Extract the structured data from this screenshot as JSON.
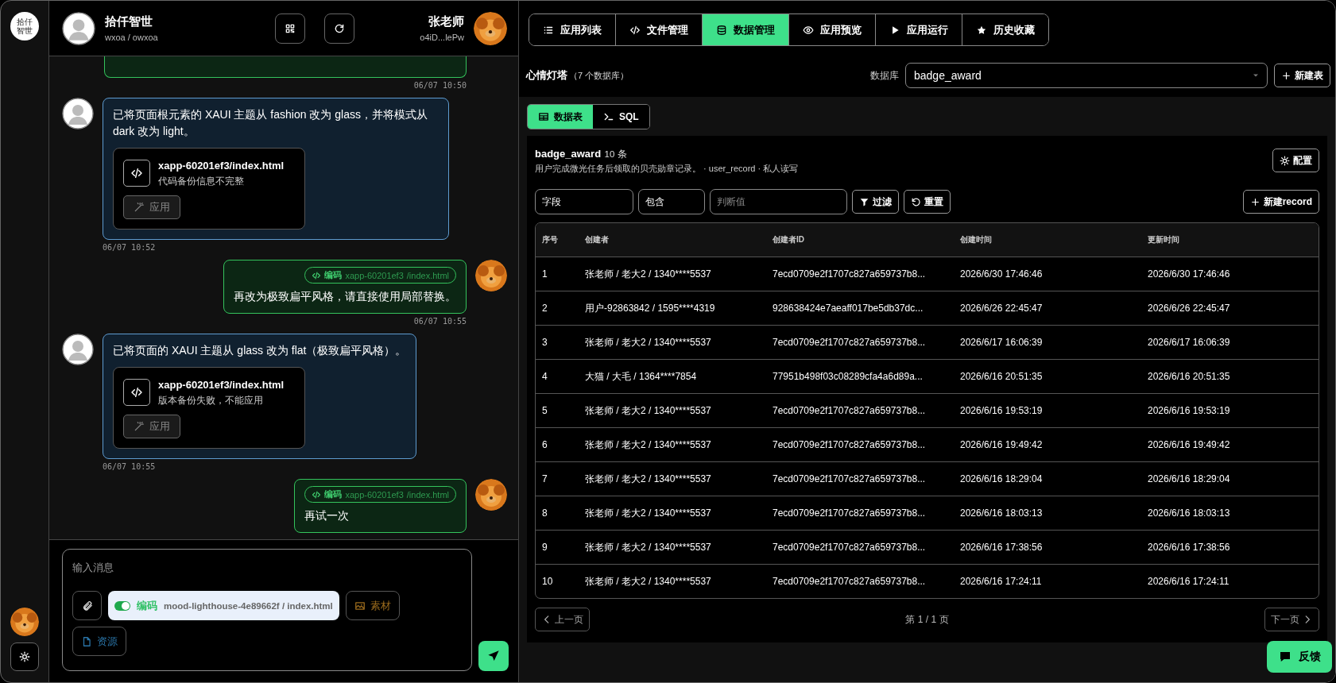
{
  "rail": {
    "logo_text": "拾仟智世"
  },
  "chat_header": {
    "name": "拾仟智世",
    "subtitle": "wxoa / owxoa",
    "user_name": "张老师",
    "user_id": "o4iD...lePw"
  },
  "messages": [
    {
      "kind": "clipped",
      "time": "06/07 10:50"
    },
    {
      "kind": "assistant",
      "text": "已将页面根元素的 XAUI 主题从 fashion 改为 glass，并将模式从 dark 改为 light。",
      "file": {
        "name": "xapp-60201ef3/index.html",
        "note": "代码备份信息不完整"
      },
      "apply": {
        "label": "应用",
        "disabled": true
      },
      "time": "06/07 10:52"
    },
    {
      "kind": "user",
      "code_ref": {
        "label": "编码",
        "project": "xapp-60201ef3",
        "file": "/index.html"
      },
      "text": "再改为极致扁平风格，请直接使用局部替换。",
      "time": "06/07 10:55"
    },
    {
      "kind": "assistant",
      "text": "已将页面的 XAUI 主题从 glass 改为 flat（极致扁平风格）。",
      "file": {
        "name": "xapp-60201ef3/index.html",
        "note": "版本备份失败，不能应用"
      },
      "apply": {
        "label": "应用",
        "disabled": true
      },
      "time": "06/07 10:55"
    },
    {
      "kind": "user",
      "code_ref": {
        "label": "编码",
        "project": "xapp-60201ef3",
        "file": "/index.html"
      },
      "text": "再试一次"
    }
  ],
  "composer": {
    "placeholder": "输入消息",
    "code_mode": {
      "on": true,
      "label": "编码",
      "path": "mood-lighthouse-4e89662f / index.html"
    },
    "assets_button": "素材",
    "resources_button": "资源"
  },
  "tabs": [
    {
      "label": "应用列表",
      "selected": false
    },
    {
      "label": "文件管理",
      "selected": false
    },
    {
      "label": "数据管理",
      "selected": true
    },
    {
      "label": "应用预览",
      "selected": false
    },
    {
      "label": "应用运行",
      "selected": false
    },
    {
      "label": "历史收藏",
      "selected": false
    }
  ],
  "database": {
    "title": "心情灯塔",
    "count": "（7 个数据库）",
    "select_label": "数据库",
    "selected": "badge_award",
    "new_table_button": "新建表"
  },
  "subtabs": [
    {
      "label": "数据表",
      "selected": true
    },
    {
      "label": "SQL",
      "selected": false
    }
  ],
  "table_info": {
    "name": "badge_award",
    "count": "10 条",
    "description": "用户完成微光任务后领取的贝壳勋章记录。 · user_record · 私人读写",
    "config_button": "配置"
  },
  "filter": {
    "field": "字段",
    "operator": "包含",
    "value_placeholder": "判断值",
    "filter_button": "过滤",
    "reset_button": "重置",
    "new_record_button": "新建record"
  },
  "table": {
    "columns": [
      "序号",
      "创建者",
      "创建者ID",
      "创建时间",
      "更新时间"
    ],
    "rows": [
      [
        "1",
        "张老师 / 老大2 / 1340****5537",
        "7ecd0709e2f1707c827a659737b8...",
        "2026/6/30 17:46:46",
        "2026/6/30 17:46:46"
      ],
      [
        "2",
        "用户-92863842 / 1595****4319",
        "928638424e7aeaff017be5db37dc...",
        "2026/6/26 22:45:47",
        "2026/6/26 22:45:47"
      ],
      [
        "3",
        "张老师 / 老大2 / 1340****5537",
        "7ecd0709e2f1707c827a659737b8...",
        "2026/6/17 16:06:39",
        "2026/6/17 16:06:39"
      ],
      [
        "4",
        "大猫 / 大毛 / 1364****7854",
        "77951b498f03c08289cfa4a6d89a...",
        "2026/6/16 20:51:35",
        "2026/6/16 20:51:35"
      ],
      [
        "5",
        "张老师 / 老大2 / 1340****5537",
        "7ecd0709e2f1707c827a659737b8...",
        "2026/6/16 19:53:19",
        "2026/6/16 19:53:19"
      ],
      [
        "6",
        "张老师 / 老大2 / 1340****5537",
        "7ecd0709e2f1707c827a659737b8...",
        "2026/6/16 19:49:42",
        "2026/6/16 19:49:42"
      ],
      [
        "7",
        "张老师 / 老大2 / 1340****5537",
        "7ecd0709e2f1707c827a659737b8...",
        "2026/6/16 18:29:04",
        "2026/6/16 18:29:04"
      ],
      [
        "8",
        "张老师 / 老大2 / 1340****5537",
        "7ecd0709e2f1707c827a659737b8...",
        "2026/6/16 18:03:13",
        "2026/6/16 18:03:13"
      ],
      [
        "9",
        "张老师 / 老大2 / 1340****5537",
        "7ecd0709e2f1707c827a659737b8...",
        "2026/6/16 17:38:56",
        "2026/6/16 17:38:56"
      ],
      [
        "10",
        "张老师 / 老大2 / 1340****5537",
        "7ecd0709e2f1707c827a659737b8...",
        "2026/6/16 17:24:11",
        "2026/6/16 17:24:11"
      ]
    ]
  },
  "pagination": {
    "prev": "上一页",
    "page": "第 1 / 1 页",
    "next": "下一页"
  },
  "feedback_button": "反馈"
}
